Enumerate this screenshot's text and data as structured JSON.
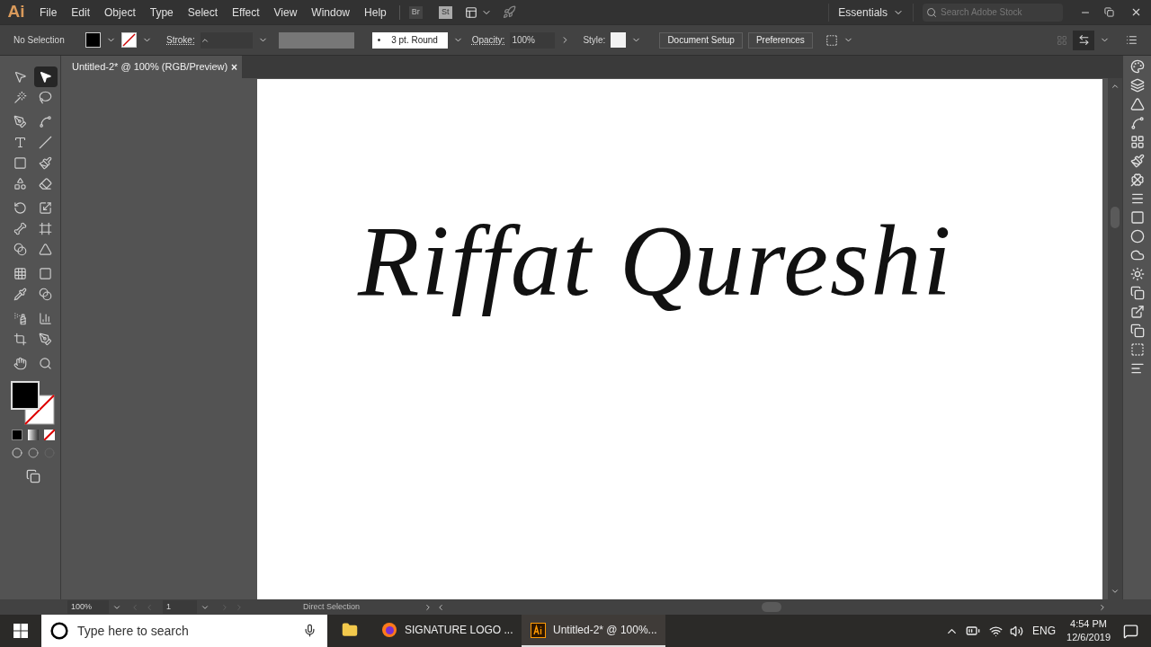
{
  "app_logo": "Ai",
  "menu": [
    "File",
    "Edit",
    "Object",
    "Type",
    "Select",
    "Effect",
    "View",
    "Window",
    "Help"
  ],
  "app_badges": [
    "Br",
    "St"
  ],
  "workspace": "Essentials",
  "stock_search": {
    "placeholder": "Search Adobe Stock"
  },
  "control_bar": {
    "selection": "No Selection",
    "stroke_label": "Stroke:",
    "brush_dot": "•",
    "brush": "3 pt. Round",
    "opacity_label": "Opacity:",
    "opacity": "100%",
    "style_label": "Style:",
    "buttons": [
      "Document Setup",
      "Preferences"
    ]
  },
  "document_tab": {
    "title": "Untitled-2* @ 100% (RGB/Preview)",
    "close": "×"
  },
  "tools": [
    {
      "selected": false
    },
    {
      "selected": true
    },
    {
      "selected": false
    },
    {
      "selected": false
    },
    {
      "selected": false
    },
    {
      "selected": false
    },
    {
      "selected": false
    },
    {
      "selected": false
    },
    {
      "selected": false
    },
    {
      "selected": false
    },
    {
      "selected": false
    },
    {
      "selected": false
    },
    {
      "selected": false
    },
    {
      "selected": false
    },
    {
      "selected": false
    },
    {
      "selected": false
    },
    {
      "selected": false
    },
    {
      "selected": false
    },
    {
      "selected": false
    },
    {
      "selected": false
    },
    {
      "selected": false
    },
    {
      "selected": false
    },
    {
      "selected": false
    },
    {
      "selected": false
    },
    {
      "selected": false
    },
    {
      "selected": false
    },
    {
      "selected": false
    },
    {
      "selected": false
    }
  ],
  "artboard": {
    "signature": "Riffat Qureshi"
  },
  "status_bar": {
    "zoom": "100%",
    "artboard": "1",
    "tool": "Direct Selection"
  },
  "taskbar": {
    "search": {
      "placeholder": "Type here to search"
    },
    "apps": [
      {
        "kind": "explorer",
        "selected": false
      },
      {
        "kind": "firefox",
        "label": "SIGNATURE LOGO ...",
        "selected": false
      },
      {
        "kind": "illustrator",
        "label": "Untitled-2* @ 100%...",
        "selected": true
      }
    ],
    "language": "ENG",
    "time": "4:54 PM",
    "date": "12/6/2019"
  }
}
